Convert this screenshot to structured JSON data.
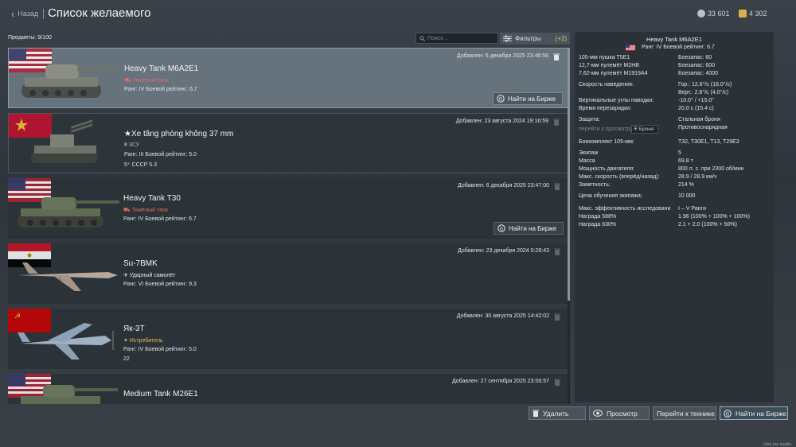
{
  "header": {
    "back_label": "Назад",
    "title": "Список желаемого",
    "silver": "33 601",
    "gold": "4 302"
  },
  "toolbar": {
    "items_label": "Предметы: 9/100",
    "search_placeholder": "Поиск...",
    "filters_label": "Фильтры",
    "filters_count": "(+2)"
  },
  "items": [
    {
      "name": "Heavy Tank M6A2E1",
      "class": "Тяжёлый танк",
      "class_color": "#e06b5d",
      "rank": "Ранг: IV Боевой рейтинг: 6.7",
      "extra": "",
      "date": "Добавлен: 6 декабря 2025 23:46:56",
      "market": "Найти на Бирже",
      "flag": "us",
      "type": "tank"
    },
    {
      "name": "★Xe tăng phòng không 37 mm",
      "class": "ЗСУ",
      "class_color": "#b8a8e8",
      "rank": "Ранг: III Боевой рейтинг: 5.0",
      "extra": "5⁺ СССР 5.3",
      "date": "Добавлен: 23 августа 2024 19:16:59",
      "market": "",
      "flag": "vn",
      "type": "spaa"
    },
    {
      "name": "Heavy Tank T30",
      "class": "Тяжёлый танк",
      "class_color": "#e06b5d",
      "rank": "Ранг: IV Боевой рейтинг: 6.7",
      "extra": "",
      "date": "Добавлен: 6 декабря 2025 23:47:00",
      "market": "Найти на Бирже",
      "flag": "us",
      "type": "tank"
    },
    {
      "name": "Su-7BMK",
      "class": "Ударный самолёт",
      "class_color": "#e8e8e8",
      "rank": "Ранг: VI Боевой рейтинг: 9.3",
      "extra": "",
      "date": "Добавлен: 23 декабря 2024 0:28:43",
      "market": "",
      "flag": "eg",
      "type": "jet"
    },
    {
      "name": "Як-3Т",
      "class": "Истребитель",
      "class_color": "#e8b84a",
      "rank": "Ранг: IV Боевой рейтинг: 5.0",
      "extra": "22",
      "date": "Добавлен: 30 августа 2025 14:42:02",
      "market": "",
      "flag": "su",
      "type": "prop"
    },
    {
      "name": "Medium Tank M26E1",
      "class": "",
      "class_color": "#e06b5d",
      "rank": "",
      "extra": "",
      "date": "Добавлен: 27 сентября 2025 23:06:57",
      "market": "",
      "flag": "us",
      "type": "tank"
    }
  ],
  "details": {
    "title": "Heavy Tank M6A2E1",
    "rank": "Ранг: IV    Боевой рейтинг: 6.7",
    "rows": [
      {
        "l": "105-мм пушка T5E1",
        "v": "Боезапас: 60"
      },
      {
        "l": "12,7-мм пулемёт M2HB",
        "v": "Боезапас: 600"
      },
      {
        "l": "7,62-мм пулемёт M1919A4",
        "v": "Боезапас: 4000"
      },
      {
        "l": "Скорость наведения:",
        "v": "Гор.: 12.6°/с (18.0°/с)"
      },
      {
        "l": "",
        "v": "Верт.: 2.8°/с (4.0°/с)"
      },
      {
        "l": "Вертикальные углы наводки:",
        "v": "-10.0° / +15.0°"
      },
      {
        "l": "Время перезарядки:",
        "v": "20.0 с (15.4 с)"
      },
      {
        "l": "Защита:",
        "v": "Стальная броня"
      },
      {
        "l": "перейти к просмотру",
        "v": "Противоснарядная"
      },
      {
        "l": "Боекомплект 105-мм:",
        "v": "T32, T30E1, T13, T29E3"
      },
      {
        "l": "Экипаж",
        "v": "5"
      },
      {
        "l": "Масса",
        "v": "69.8 т"
      },
      {
        "l": "Мощность двигателя:",
        "v": "800 л. с. при 2300 об/мин"
      },
      {
        "l": "Макс. скорость (вперёд/назад):",
        "v": "28.9 / 28.9 км/ч"
      },
      {
        "l": "Заметность:",
        "v": "214 %"
      },
      {
        "l": "Цена обучения экипажа:",
        "v": "10 000"
      },
      {
        "l": "Макс. эффективность исследовани",
        "v": "I – V Ранги"
      },
      {
        "l": "Награда 588%",
        "v": "1.96 (100% + 100% + 100%)"
      },
      {
        "l": "Награда 630%",
        "v": "2.1 + 2.0 (100% + 50%)"
      }
    ],
    "armor_label": "Броня"
  },
  "footer": {
    "delete": "Удалить",
    "view": "Просмотр",
    "goto": "Перейти к технике",
    "market": "Найти на Бирже",
    "quality": "Ultra low quality"
  }
}
